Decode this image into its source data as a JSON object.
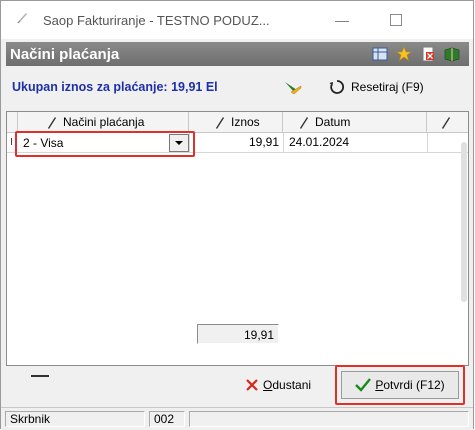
{
  "window": {
    "title": "Saop Fakturiranje - TESTNO PODUZ...",
    "minimize_glyph": "—"
  },
  "header": {
    "title": "Načini plaćanja",
    "icons": [
      "columns-icon",
      "star-icon",
      "delete-icon",
      "book-icon"
    ]
  },
  "info": {
    "total_label": "Ukupan iznos za plaćanje: 19,91 El",
    "reset_label": "Resetiraj (F9)"
  },
  "grid": {
    "indicator_header": "",
    "columns": [
      "Načini plaćanja",
      "Iznos",
      "Datum",
      ""
    ],
    "rows": [
      {
        "indicator": "I",
        "method": "2 - Visa",
        "amount": "19,91",
        "date": "24.01.2024"
      }
    ],
    "sum": "19,91"
  },
  "buttons": {
    "cancel_prefix": "",
    "cancel_underline": "O",
    "cancel_rest": "dustani",
    "confirm_underline": "P",
    "confirm_rest": "otvrdi (F12)"
  },
  "status": {
    "user": "Skrbnik",
    "code": "002",
    "extra": ""
  },
  "colors": {
    "highlight": "#e0302a",
    "total_text": "#1f2fa8",
    "header_bg": "#7a7a7a"
  }
}
